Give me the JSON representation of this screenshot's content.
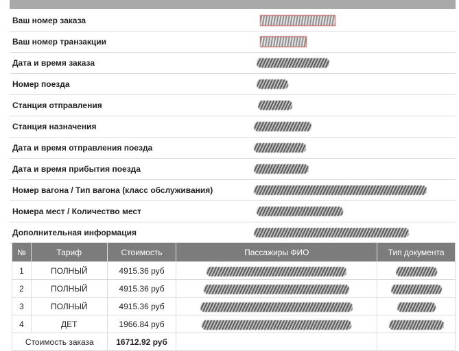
{
  "order_info": [
    {
      "label": "Ваш номер заказа"
    },
    {
      "label": "Ваш номер транзакции"
    },
    {
      "label": "Дата и время заказа"
    },
    {
      "label": "Номер поезда"
    },
    {
      "label": "Станция отправления"
    },
    {
      "label": "Станция назначения"
    },
    {
      "label": "Дата и время отправления поезда"
    },
    {
      "label": "Дата и время прибытия поезда"
    },
    {
      "label": "Номер вагона / Тип вагона (класс обслуживания)"
    },
    {
      "label": "Номера мест / Количество мест"
    },
    {
      "label": "Дополнительная информация"
    }
  ],
  "table": {
    "headers": [
      "№",
      "Тариф",
      "Стоимость",
      "Пассажиры ФИО",
      "Тип документа"
    ],
    "rows": [
      {
        "num": "1",
        "tariff": "ПОЛНЫЙ",
        "cost": "4915.36 руб"
      },
      {
        "num": "2",
        "tariff": "ПОЛНЫЙ",
        "cost": "4915.36 руб"
      },
      {
        "num": "3",
        "tariff": "ПОЛНЫЙ",
        "cost": "4915.36 руб"
      },
      {
        "num": "4",
        "tariff": "ДЕТ",
        "cost": "1966.84 руб"
      }
    ],
    "total_label": "Стоимость заказа",
    "total_value": "16712.92 руб"
  },
  "colors": {
    "header_bg": "#7c7c7c",
    "top_bar": "#a9a9a9",
    "highlight_border": "#c0504d"
  }
}
